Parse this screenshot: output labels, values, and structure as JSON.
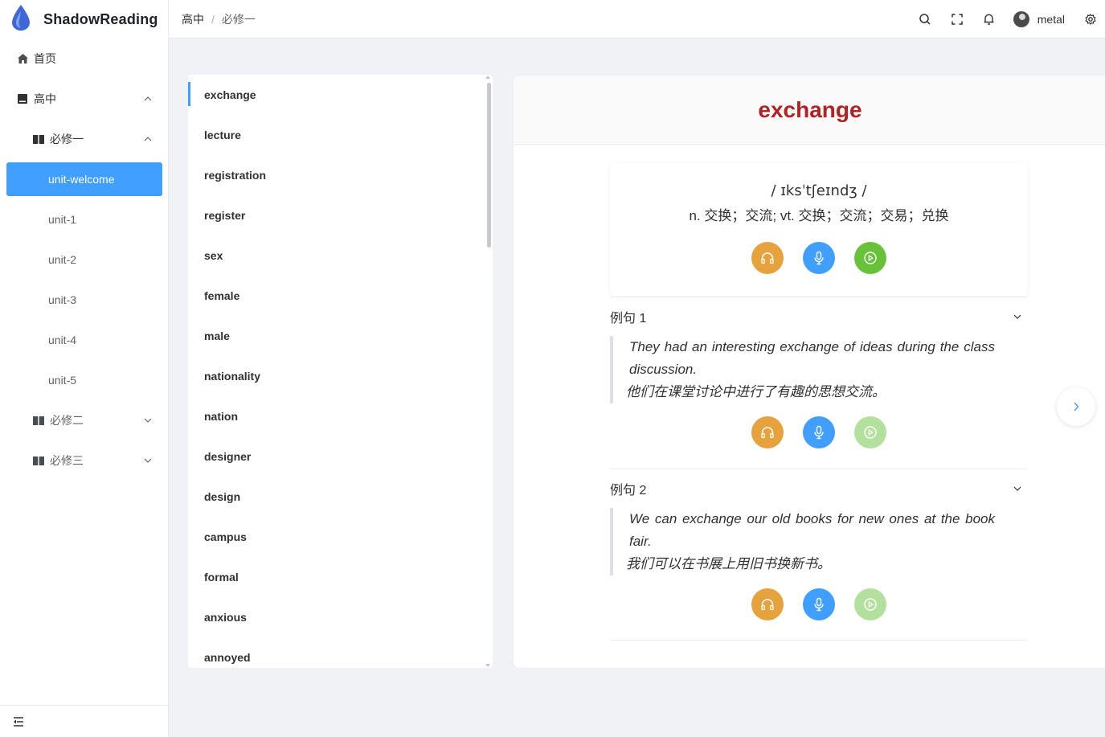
{
  "app": {
    "name": "ShadowReading"
  },
  "sidebar": {
    "home": "首页",
    "group": "高中",
    "book1": "必修一",
    "units": [
      "unit-welcome",
      "unit-1",
      "unit-2",
      "unit-3",
      "unit-4",
      "unit-5"
    ],
    "book2": "必修二",
    "book3": "必修三"
  },
  "header": {
    "breadcrumb": [
      "高中",
      "必修一"
    ],
    "separator": "/",
    "username": "metal"
  },
  "words": [
    "exchange",
    "lecture",
    "registration",
    "register",
    "sex",
    "female",
    "male",
    "nationality",
    "nation",
    "designer",
    "design",
    "campus",
    "formal",
    "anxious",
    "annoyed"
  ],
  "detail": {
    "word": "exchange",
    "phonetic": "/ ɪksˈtʃeɪndʒ /",
    "meaning": "n. 交换；交流; vt. 交换；交流；交易；兑换",
    "examples": [
      {
        "label": "例句 1",
        "en": "They had an interesting exchange of ideas during the class discussion.",
        "zh": "他们在课堂讨论中进行了有趣的思想交流。"
      },
      {
        "label": "例句 2",
        "en": "We can exchange our old books for new ones at the book fair.",
        "zh": "我们可以在书展上用旧书换新书。"
      }
    ]
  },
  "colors": {
    "accent": "#409eff",
    "title": "#b22222",
    "listen": "#e6a23c",
    "record": "#409eff",
    "play": "#67c23a"
  },
  "icons": [
    "headphones-icon",
    "microphone-icon",
    "play-icon",
    "search-icon",
    "fullscreen-icon",
    "bell-icon",
    "gear-icon"
  ]
}
